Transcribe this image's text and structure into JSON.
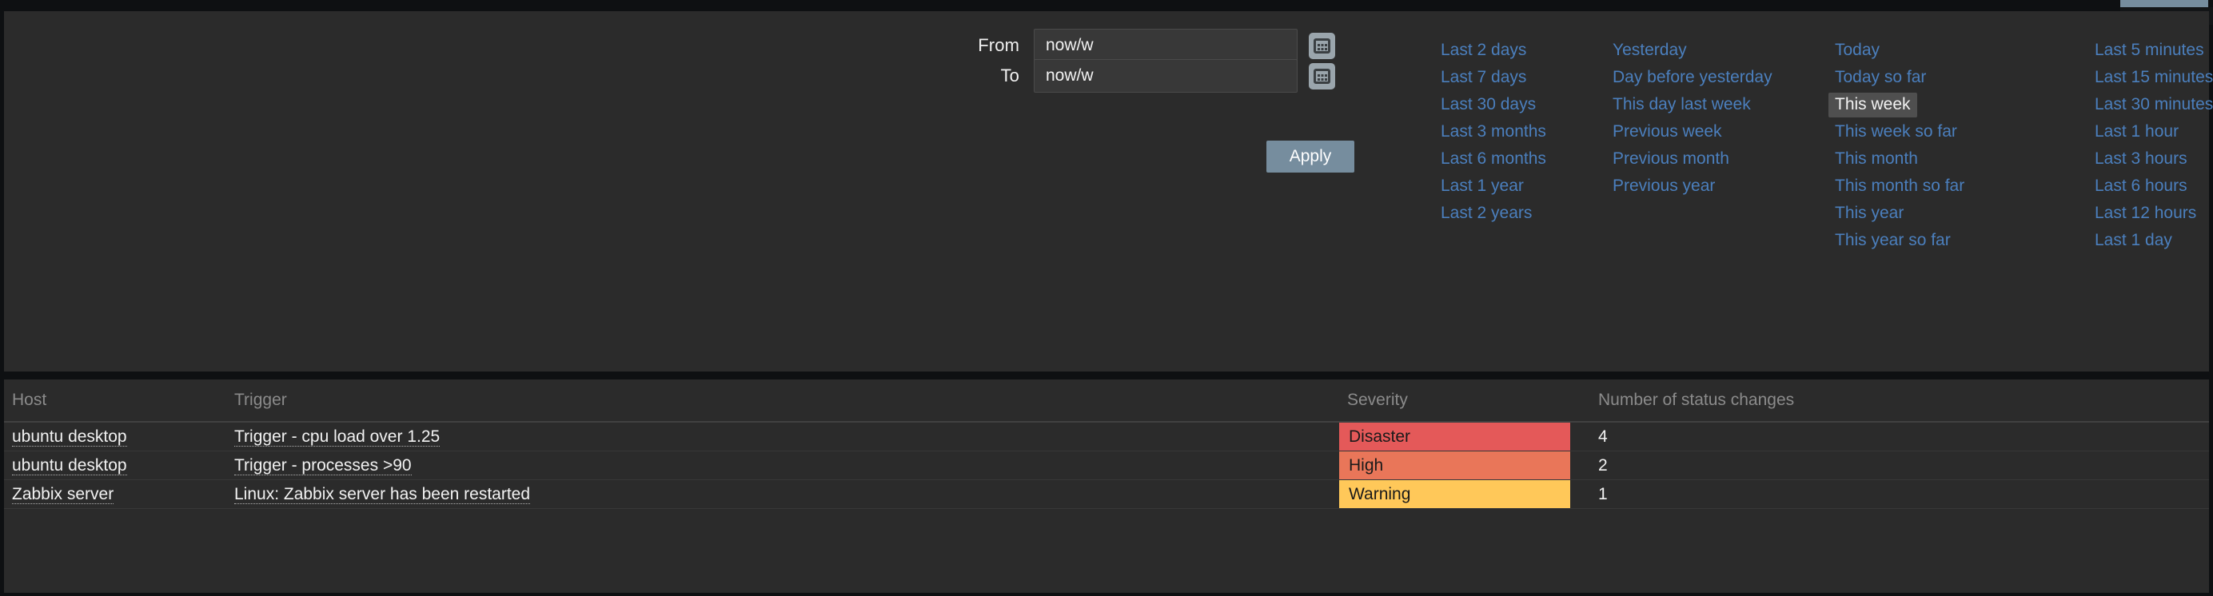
{
  "time_selector": {
    "from": {
      "label": "From",
      "value": "now/w",
      "calendar_icon": "calendar-icon"
    },
    "to": {
      "label": "To",
      "value": "now/w",
      "calendar_icon": "calendar-icon"
    },
    "apply_label": "Apply",
    "quick_ranges": {
      "col1": [
        "Last 2 days",
        "Last 7 days",
        "Last 30 days",
        "Last 3 months",
        "Last 6 months",
        "Last 1 year",
        "Last 2 years"
      ],
      "col2": [
        "Yesterday",
        "Day before yesterday",
        "This day last week",
        "Previous week",
        "Previous month",
        "Previous year"
      ],
      "col3": [
        "Today",
        "Today so far",
        "This week",
        "This week so far",
        "This month",
        "This month so far",
        "This year",
        "This year so far"
      ],
      "col4": [
        "Last 5 minutes",
        "Last 15 minutes",
        "Last 30 minutes",
        "Last 1 hour",
        "Last 3 hours",
        "Last 6 hours",
        "Last 12 hours",
        "Last 1 day"
      ],
      "selected": "This week"
    }
  },
  "table": {
    "headers": {
      "host": "Host",
      "trigger": "Trigger",
      "severity": "Severity",
      "changes": "Number of status changes"
    },
    "rows": [
      {
        "host": "ubuntu desktop",
        "trigger": "Trigger - cpu load over 1.25",
        "severity": "Disaster",
        "severity_class": "sev-disaster",
        "changes": "4"
      },
      {
        "host": "ubuntu desktop",
        "trigger": "Trigger - processes >90",
        "severity": "High",
        "severity_class": "sev-high",
        "changes": "2"
      },
      {
        "host": "Zabbix server",
        "trigger": "Linux: Zabbix server has been restarted",
        "severity": "Warning",
        "severity_class": "sev-warning",
        "changes": "1"
      }
    ]
  },
  "colors": {
    "panel_bg": "#2b2b2b",
    "page_bg": "#0e1012",
    "link": "#4b7fbd",
    "accent_button": "#768d9e",
    "selected_range_bg": "#4f4f4f",
    "severity_disaster": "#e45959",
    "severity_high": "#e97659",
    "severity_warning": "#ffc859"
  }
}
